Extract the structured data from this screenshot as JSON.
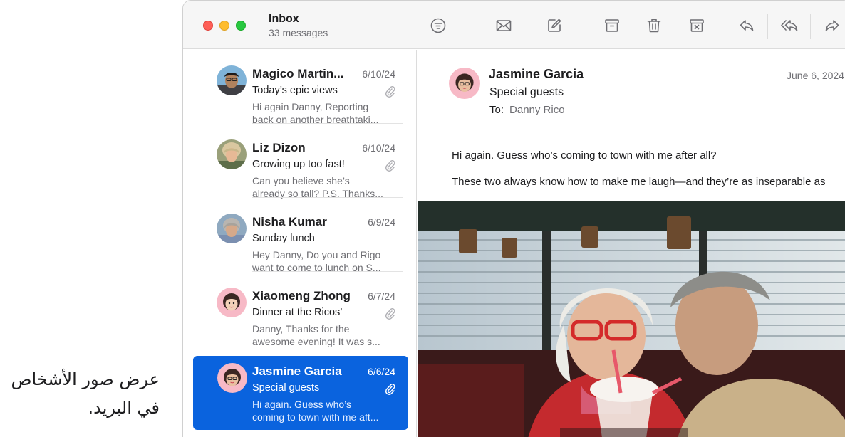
{
  "callout": {
    "line1": "عرض صور الأشخاص",
    "line2": "في البريد."
  },
  "window": {
    "title": "Inbox",
    "subtitle": "33 messages"
  },
  "toolbar": {
    "icons": [
      "filter-icon",
      "envelope-icon",
      "compose-icon",
      "archive-icon",
      "trash-icon",
      "junk-icon",
      "reply-icon",
      "reply-all-icon",
      "forward-icon"
    ]
  },
  "messages": [
    {
      "sender": "Magico Martin...",
      "date": "6/10/24",
      "subject": "Today’s epic views",
      "preview1": "Hi again Danny, Reporting",
      "preview2": "back on another breathtaki...",
      "attachment": true
    },
    {
      "sender": "Liz Dizon",
      "date": "6/10/24",
      "subject": "Growing up too fast!",
      "preview1": "Can you believe she’s",
      "preview2": "already so tall? P.S. Thanks...",
      "attachment": true
    },
    {
      "sender": "Nisha Kumar",
      "date": "6/9/24",
      "subject": "Sunday lunch",
      "preview1": "Hey Danny, Do you and Rigo",
      "preview2": "want to come to lunch on S...",
      "attachment": false
    },
    {
      "sender": "Xiaomeng Zhong",
      "date": "6/7/24",
      "subject": "Dinner at the Ricos’",
      "preview1": "Danny, Thanks for the",
      "preview2": "awesome evening! It was s...",
      "attachment": true
    },
    {
      "sender": "Jasmine Garcia",
      "date": "6/6/24",
      "subject": "Special guests",
      "preview1": "Hi again. Guess who’s",
      "preview2": "coming to town with me aft...",
      "attachment": true,
      "selected": true
    }
  ],
  "reading": {
    "sender": "Jasmine Garcia",
    "date": "June 6, 2024",
    "subject": "Special guests",
    "to_label": "To:",
    "to_name": "Danny Rico",
    "body1": "Hi again. Guess who’s coming to town with me after all?",
    "body2": "These two always know how to make me laugh—and they’re as inseparable as"
  },
  "colors": {
    "accent": "#0a63de",
    "close": "#fe5f57",
    "minimize": "#febc2e",
    "maximize": "#28c840"
  }
}
